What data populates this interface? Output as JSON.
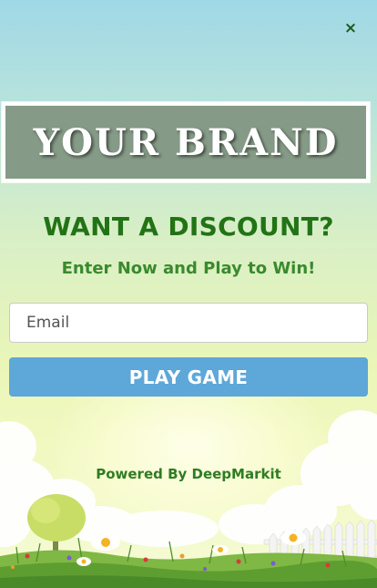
{
  "popup": {
    "close_glyph": "×",
    "brand_text": "YOUR BRAND",
    "headline": "WANT A DISCOUNT?",
    "subheadline": "Enter Now and Play to Win!",
    "email_placeholder": "Email",
    "play_button_label": "PLAY GAME",
    "powered_by": "Powered By DeepMarkit"
  },
  "colors": {
    "brand_box": "#869b87",
    "headline": "#227316",
    "play_button": "#5ea7d9",
    "close_icon": "#1f5a1f"
  }
}
